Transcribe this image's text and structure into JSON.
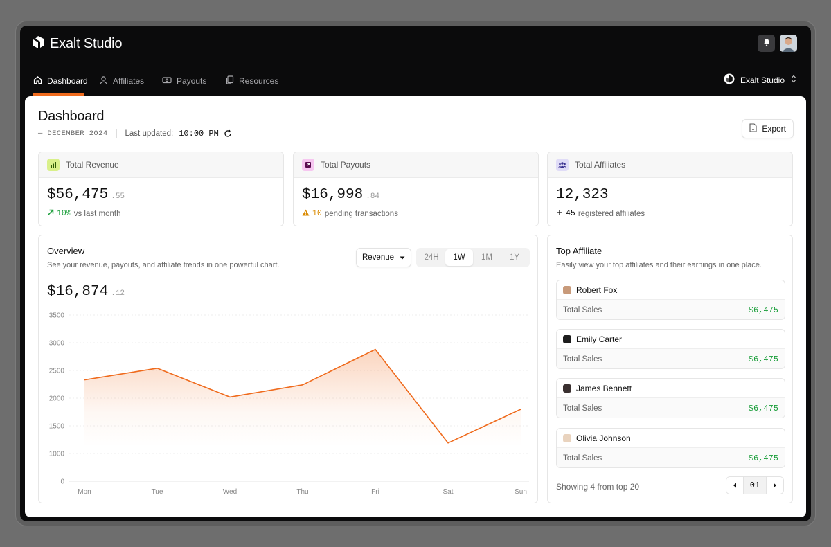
{
  "app": {
    "name": "Exalt Studio"
  },
  "nav": {
    "items": [
      {
        "label": "Dashboard",
        "icon": "home-icon",
        "active": true
      },
      {
        "label": "Affiliates",
        "icon": "user-icon",
        "active": false
      },
      {
        "label": "Payouts",
        "icon": "banknote-icon",
        "active": false
      },
      {
        "label": "Resources",
        "icon": "files-icon",
        "active": false
      }
    ],
    "workspace": "Exalt Studio"
  },
  "page": {
    "title": "Dashboard",
    "date": "— DECEMBER 2024",
    "updated_label": "Last updated:",
    "updated_time": "10:00 PM",
    "export_label": "Export"
  },
  "stats": [
    {
      "title": "Total Revenue",
      "value": "$56,475",
      "cents": ".55",
      "delta": "10%",
      "foot": "vs last month",
      "icon": "bar-chart-icon",
      "icon_bg": "#d9f08a",
      "icon_color": "#2e5a05"
    },
    {
      "title": "Total Payouts",
      "value": "$16,998",
      "cents": ".84",
      "delta": "10",
      "foot": "pending transactions",
      "icon": "arrow-out-icon",
      "icon_bg": "#f6c6f0",
      "icon_color": "#5a0c4f"
    },
    {
      "title": "Total Affiliates",
      "value": "12,323",
      "cents": "",
      "delta": "45",
      "foot": "registered affiliates",
      "icon": "users-icon",
      "icon_bg": "#e0dcf7",
      "icon_color": "#3b3290"
    }
  ],
  "overview": {
    "title": "Overview",
    "description": "See your revenue, payouts, and affiliate trends in one powerful chart.",
    "metric": "Revenue",
    "ranges": [
      "24H",
      "1W",
      "1M",
      "1Y"
    ],
    "active_range": "1W",
    "value": "$16,874",
    "cents": ".12"
  },
  "chart_data": {
    "type": "area",
    "categories": [
      "Mon",
      "Tue",
      "Wed",
      "Thu",
      "Fri",
      "Sat",
      "Sun"
    ],
    "values": [
      2330,
      2540,
      2020,
      2240,
      2880,
      1190,
      1800
    ],
    "ylim": [
      0,
      3500
    ],
    "yticks": [
      0,
      1000,
      1500,
      2000,
      2500,
      3000,
      3500
    ],
    "color": "#ef6a1c",
    "grid": true
  },
  "top_affiliates": {
    "title": "Top Affiliate",
    "description": "Easily view your top affiliates and their earnings in one place.",
    "sales_label": "Total Sales",
    "items": [
      {
        "name": "Robert Fox",
        "amount": "$6,475"
      },
      {
        "name": "Emily Carter",
        "amount": "$6,475"
      },
      {
        "name": "James Bennett",
        "amount": "$6,475"
      },
      {
        "name": "Olivia Johnson",
        "amount": "$6,475"
      }
    ],
    "showing": "Showing 4 from top 20",
    "page": "01"
  },
  "colors": {
    "accent": "#f06b1d",
    "positive": "#1a9e3a",
    "warning": "#d98a00"
  }
}
